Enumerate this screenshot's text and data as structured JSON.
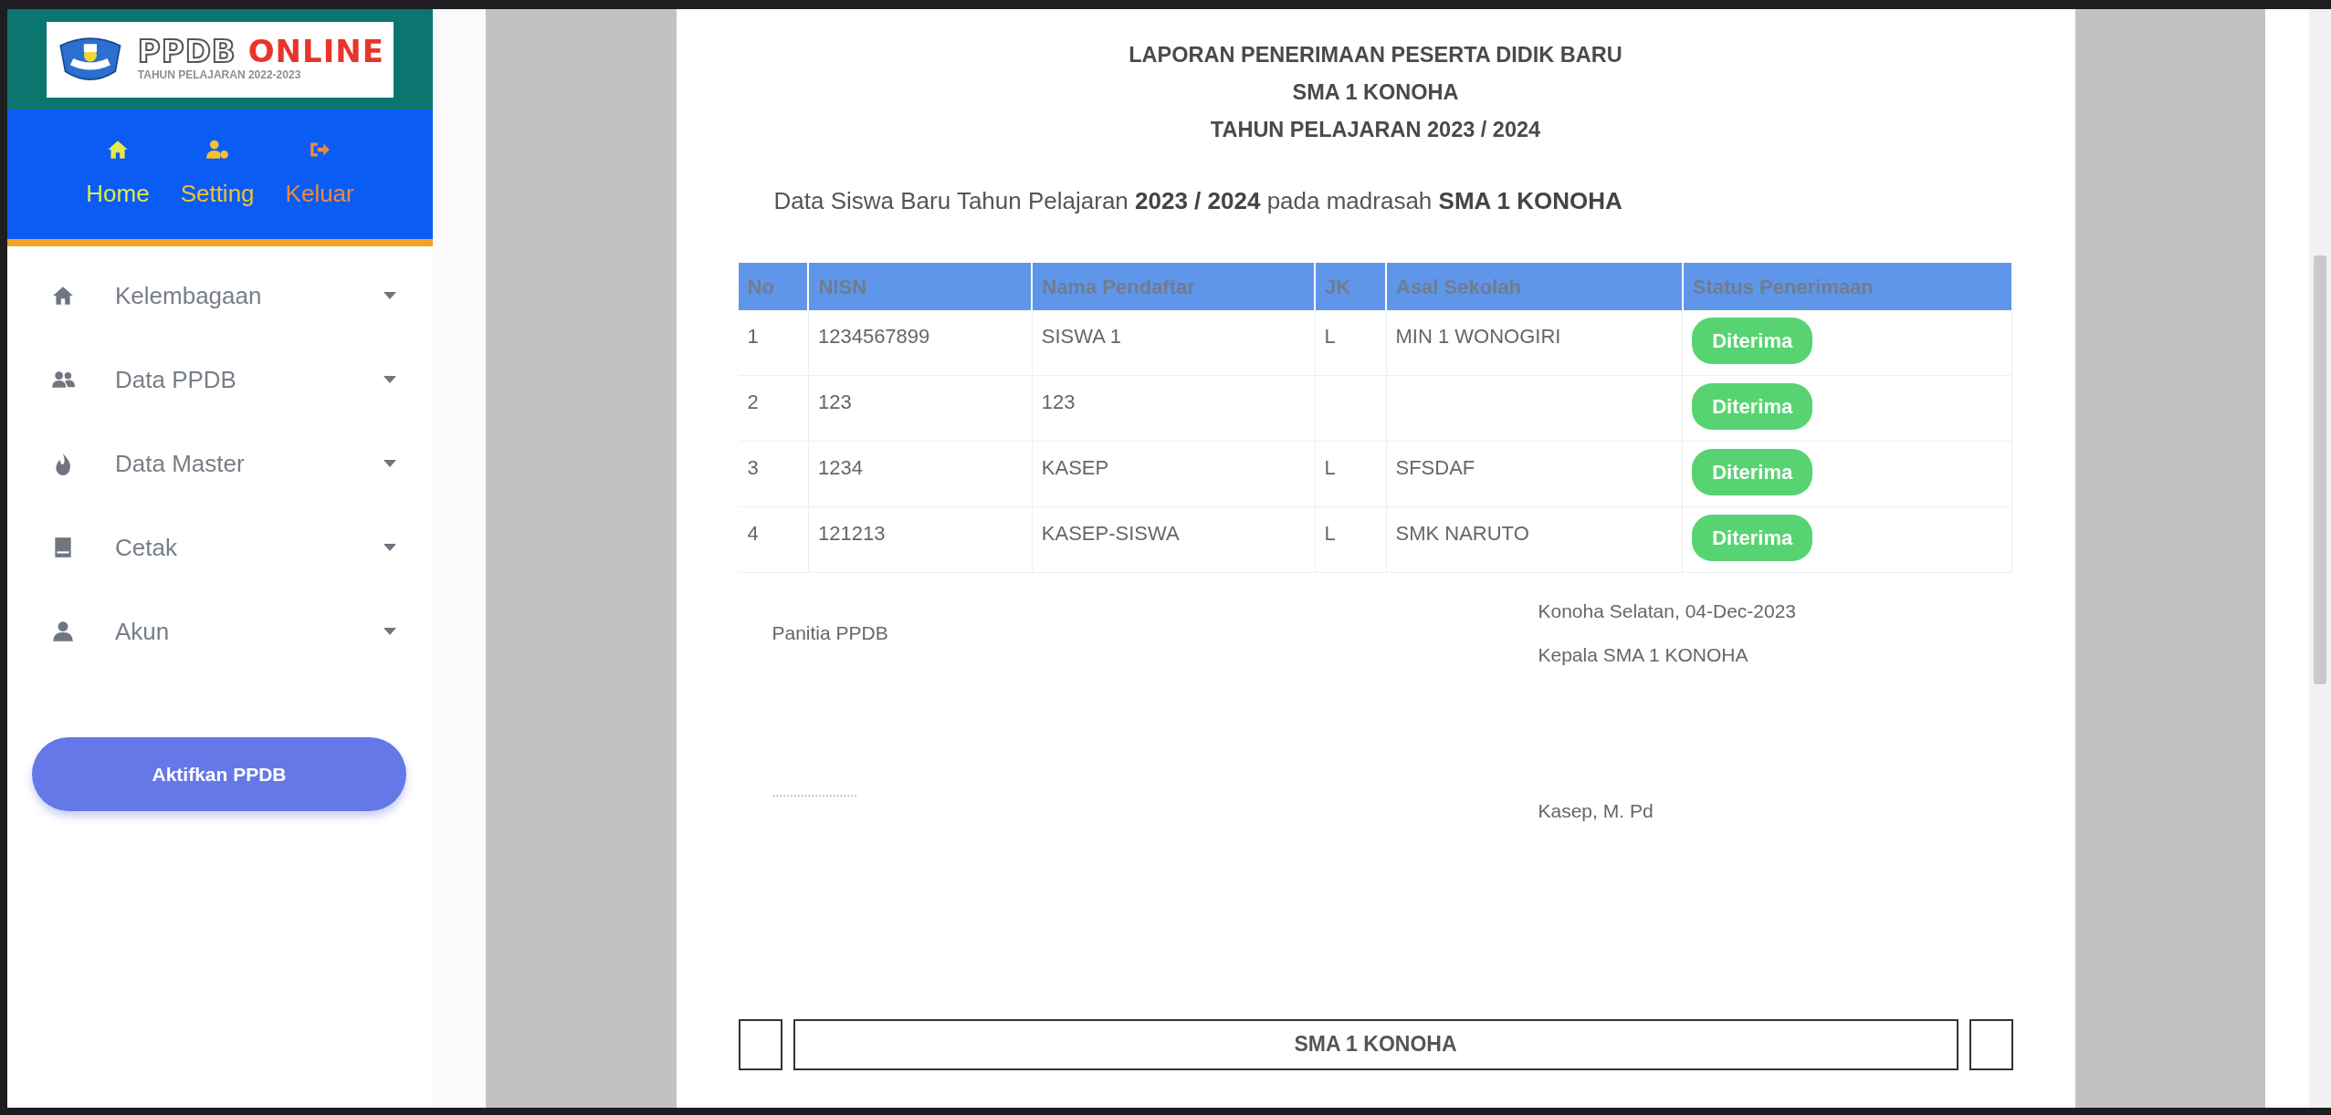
{
  "logo": {
    "title": "PPDB",
    "title_accent": "ONLINE",
    "subtitle": "TAHUN PELAJARAN 2022-2023"
  },
  "top_nav": [
    {
      "label": "Home",
      "kind": "home",
      "color": "#e3e94a"
    },
    {
      "label": "Setting",
      "kind": "usergear",
      "color": "#f1c232"
    },
    {
      "label": "Keluar",
      "kind": "exit",
      "color": "#f08a3c"
    }
  ],
  "sidebar": {
    "items": [
      {
        "label": "Kelembagaan",
        "kind": "home"
      },
      {
        "label": "Data PPDB",
        "kind": "users"
      },
      {
        "label": "Data Master",
        "kind": "drop"
      },
      {
        "label": "Cetak",
        "kind": "book"
      },
      {
        "label": "Akun",
        "kind": "user"
      }
    ]
  },
  "activate_button": "Aktifkan PPDB",
  "report": {
    "title_lines": [
      "LAPORAN PENERIMAAN PESERTA DIDIK BARU",
      "SMA 1 KONOHA",
      "TAHUN PELAJARAN 2023 / 2024"
    ],
    "intro": "Data Siswa Baru Tahun Pelajaran **2023 / 2024** pada madrasah **SMA 1 KONOHA**",
    "table": {
      "columns": [
        "No",
        "NISN",
        "Nama Pendaftar",
        "JK",
        "Asal Sekolah",
        "Status Penerimaan"
      ],
      "rows": [
        {
          "no": "1",
          "nisn": "1234567899",
          "name": "SISWA 1",
          "jk": "L",
          "school": "MIN 1 WONOGIRI",
          "status": "Diterima"
        },
        {
          "no": "2",
          "nisn": "123",
          "name": "123",
          "status": "Diterima"
        },
        {
          "no": "3",
          "nisn": "1234",
          "name": "KASEP",
          "jk": "L",
          "school": "SFSDAF",
          "status": "Diterima"
        },
        {
          "no": "4",
          "nisn": "121213",
          "name": "KASEP-SISWA",
          "jk": "L",
          "school": "SMK NARUTO",
          "status": "Diterima"
        }
      ]
    },
    "signatures": {
      "left": {
        "role": "Panitia PPDB",
        "name": "........................"
      },
      "right": {
        "place_date": "Konoha Selatan, 04-Dec-2023",
        "role": "Kepala SMA 1 KONOHA",
        "name": "Kasep, M. Pd"
      }
    },
    "footer": {
      "text": "SMA 1 KONOHA"
    }
  }
}
